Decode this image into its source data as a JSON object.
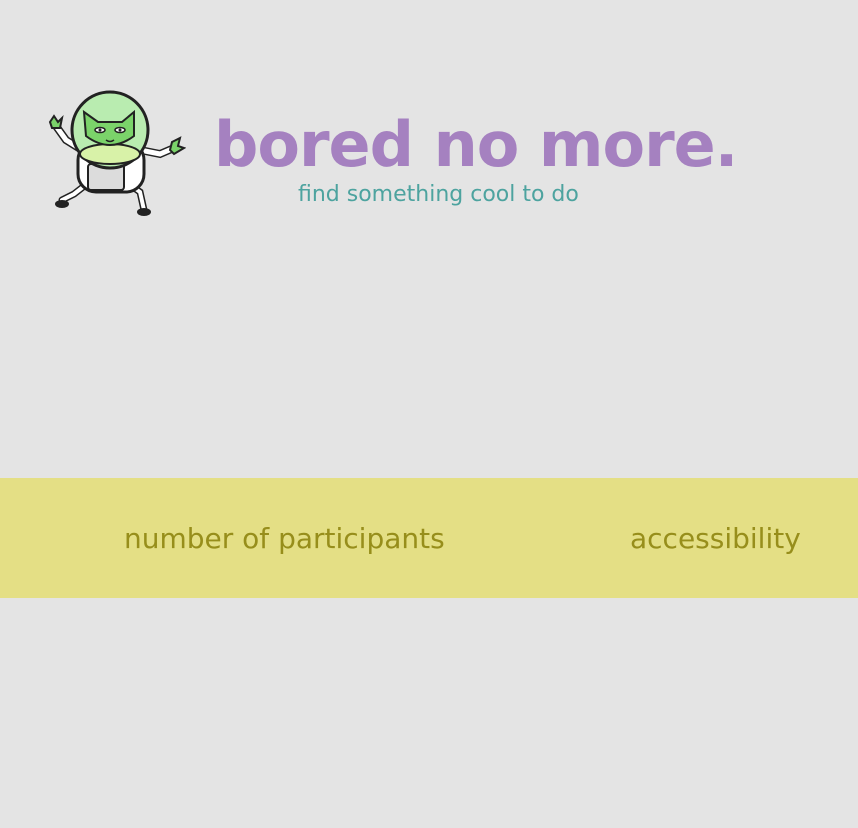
{
  "header": {
    "title": "bored no more.",
    "tagline": "find something cool to do",
    "mascot_icon": "astronaut-cat-icon"
  },
  "filters": {
    "items": [
      {
        "label": "number of participants"
      },
      {
        "label": "accessibility"
      }
    ]
  },
  "colors": {
    "background": "#e4e4e4",
    "title": "#a581c0",
    "tagline": "#4da39f",
    "filter_bar": "#e4df85",
    "filter_text": "#978e1b"
  }
}
